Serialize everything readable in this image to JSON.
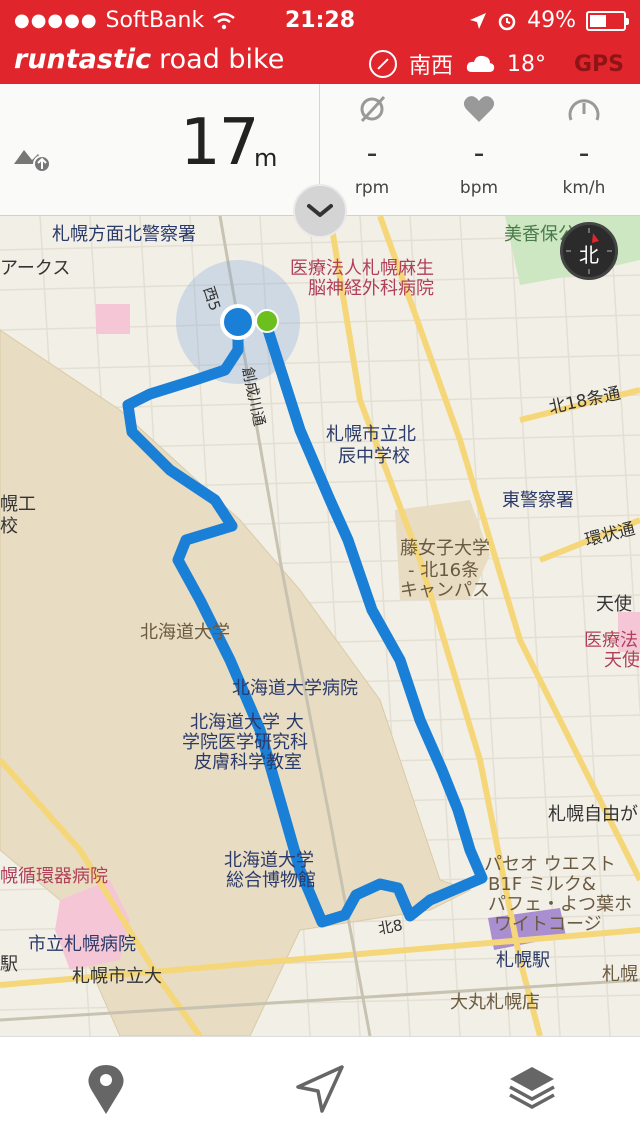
{
  "status_bar": {
    "signal": "●●●●●",
    "carrier": "SoftBank",
    "time": "21:28",
    "battery": "49%",
    "battery_level": 0.49
  },
  "header": {
    "brand": "runtastic",
    "product": "road bike",
    "heading": "南西",
    "temperature": "18°",
    "gps": "GPS",
    "colors": {
      "accent": "#e0262c",
      "gps": "#8e1418"
    }
  },
  "stats": {
    "altitude_value": "17",
    "altitude_unit": "m",
    "cadence": {
      "value": "-",
      "unit": "rpm"
    },
    "heart_rate": {
      "value": "-",
      "unit": "bpm"
    },
    "speed": {
      "value": "-",
      "unit": "km/h"
    }
  },
  "map": {
    "compass_label": "北",
    "route_color": "#1a7fd6",
    "labels": {
      "police_north": "札幌方面北警察署",
      "arcs": "アークス",
      "mikaho": "美香保公園",
      "clinic1": "医療法人札幌麻生",
      "clinic2": "脳神経外科病院",
      "nishi5": "西5",
      "ikawa": "創成川通",
      "north18": "北18条通",
      "jhs1": "札幌市立北",
      "jhs2": "辰中学校",
      "east_police": "東警察署",
      "ko1": "幌工",
      "ko2": "校",
      "fuji1": "藤女子大学",
      "fuji2": "- 北16条",
      "fuji3": "キャンパス",
      "kanjo": "環状通",
      "tenshi": "天使",
      "iryo_tenshi1": "医療法",
      "iryo_tenshi2": "天使",
      "hokudai": "北海道大学",
      "hokudai_hosp": "北海道大学病院",
      "derm1": "北海道大学 大",
      "derm2": "学院医学研究科",
      "derm3": "皮膚科学教室",
      "sapporo_jiyu": "札幌自由が",
      "paseo1": "パセオ ウエスト",
      "paseo2": "B1F ミルク&",
      "paseo3": "パフェ・よつ葉ホ",
      "paseo4": "ワイトコージ",
      "museum1": "北海道大学",
      "museum2": "総合博物館",
      "junkanki": "幌循環器病院",
      "shiritsu": "市立札幌病院",
      "eki_left": "駅",
      "shiritsudai": "札幌市立大",
      "kita8": "北8",
      "sapporo_sta": "札幌駅",
      "sapporo_right": "札幌",
      "daimaru": "大丸札幌店"
    }
  },
  "toolbar": {
    "items": [
      "map-pin",
      "navigation-arrow",
      "layers"
    ]
  }
}
